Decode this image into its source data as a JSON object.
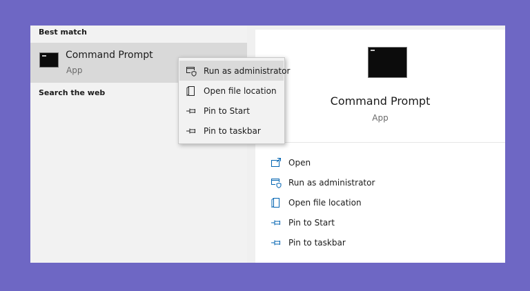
{
  "start_menu": {
    "best_match_header": "Best match",
    "search_web_header": "Search the web",
    "result": {
      "title": "Command Prompt",
      "subtitle": "App",
      "icon": "cmd-icon"
    }
  },
  "context_menu": {
    "items": [
      {
        "label": "Run as administrator",
        "icon": "shield-window-icon",
        "highlighted": true
      },
      {
        "label": "Open file location",
        "icon": "folder-icon"
      },
      {
        "label": "Pin to Start",
        "icon": "pin-icon"
      },
      {
        "label": "Pin to taskbar",
        "icon": "pin-icon"
      }
    ]
  },
  "preview": {
    "title": "Command Prompt",
    "subtitle": "App",
    "actions": [
      {
        "label": "Open",
        "icon": "open-icon"
      },
      {
        "label": "Run as administrator",
        "icon": "shield-window-icon"
      },
      {
        "label": "Open file location",
        "icon": "folder-icon"
      },
      {
        "label": "Pin to Start",
        "icon": "pin-icon"
      },
      {
        "label": "Pin to taskbar",
        "icon": "pin-icon"
      }
    ]
  },
  "colors": {
    "background": "#6e67c4",
    "accent": "#0063b1",
    "hover": "#d9d9d9"
  }
}
